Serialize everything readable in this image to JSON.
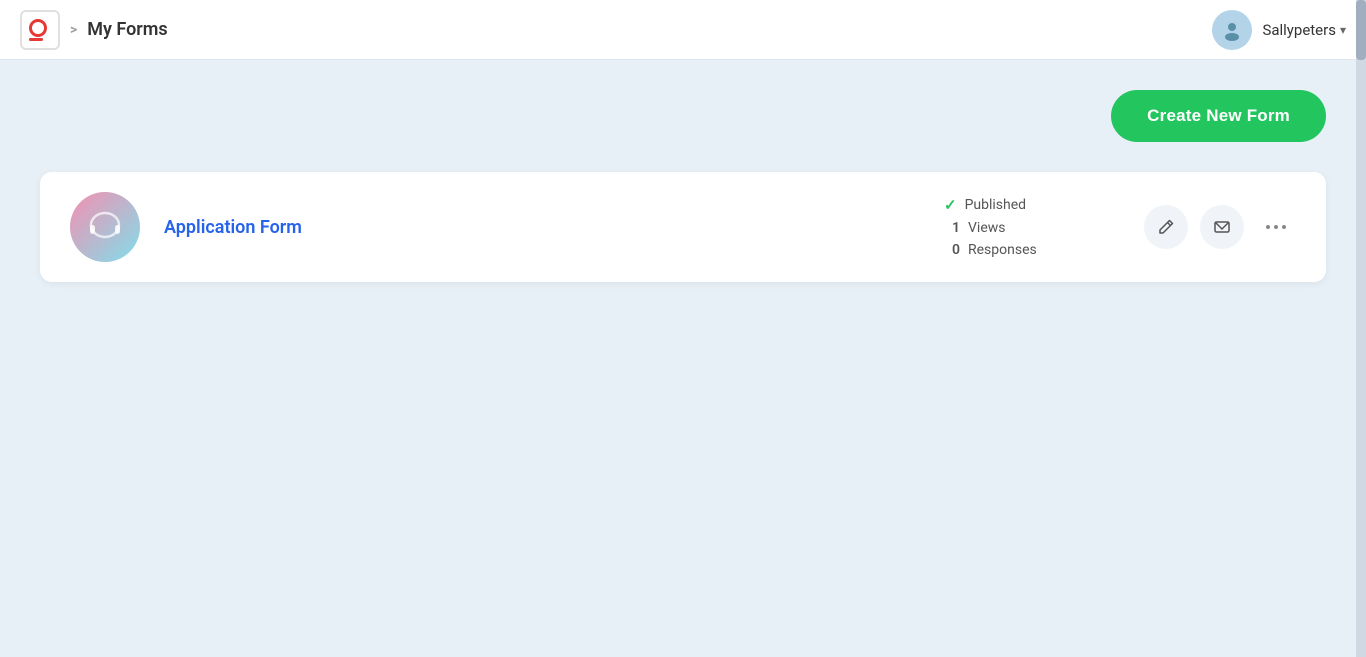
{
  "header": {
    "logo_aria": "app-logo",
    "breadcrumb_separator": ">",
    "breadcrumb_label": "My Forms",
    "username": "Sallypeters",
    "dropdown_arrow": "▾"
  },
  "toolbar": {
    "create_button_label": "Create New Form"
  },
  "forms": [
    {
      "id": "form-1",
      "name": "Application Form",
      "status": "Published",
      "views_count": "1",
      "views_label": "Views",
      "responses_count": "0",
      "responses_label": "Responses"
    }
  ],
  "actions": {
    "edit_icon": "✏",
    "email_icon": "✉",
    "more_icon": "•••"
  },
  "icons": {
    "chevron_right": "›",
    "user_icon": "👤",
    "check_icon": "✓"
  }
}
